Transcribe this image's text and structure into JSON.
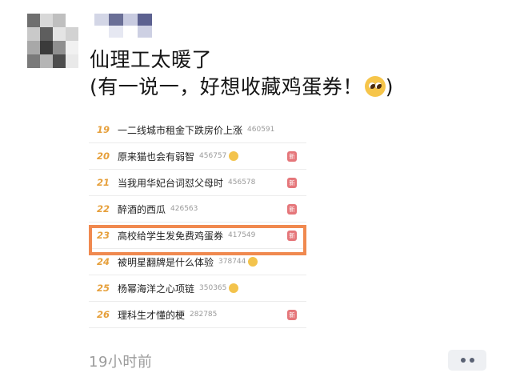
{
  "post": {
    "line1": "仙理工太暖了",
    "line2": "(有一说一，好想收藏鸡蛋券！",
    "line2_tail": ")",
    "emoji": "drooling-face-emoji"
  },
  "hot_list": [
    {
      "rank": "19",
      "title": "一二线城市租金下跌房价上涨",
      "count": "460591",
      "emoji": false,
      "badge": ""
    },
    {
      "rank": "20",
      "title": "原来猫也会有弱智",
      "count": "456757",
      "emoji": true,
      "badge": "新"
    },
    {
      "rank": "21",
      "title": "当我用华妃台词怼父母时",
      "count": "456578",
      "emoji": false,
      "badge": "新"
    },
    {
      "rank": "22",
      "title": "醉酒的西瓜",
      "count": "426563",
      "emoji": false,
      "badge": "新"
    },
    {
      "rank": "23",
      "title": "高校给学生发免费鸡蛋券",
      "count": "417549",
      "emoji": false,
      "badge": "新"
    },
    {
      "rank": "24",
      "title": "被明星翻牌是什么体验",
      "count": "378744",
      "emoji": true,
      "badge": ""
    },
    {
      "rank": "25",
      "title": "杨幂海洋之心项链",
      "count": "350365",
      "emoji": true,
      "badge": ""
    },
    {
      "rank": "26",
      "title": "理科生才懂的梗",
      "count": "282785",
      "emoji": false,
      "badge": "新"
    }
  ],
  "footer": {
    "time": "19小时前"
  },
  "colors": {
    "rank": "#e6a03c",
    "badge": "#e5767a",
    "highlight": "#f0894f",
    "time": "#9c9c9c"
  }
}
